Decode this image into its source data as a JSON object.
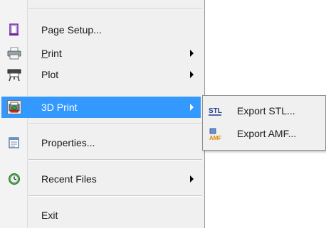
{
  "menu": {
    "items": [
      {
        "id": "page-setup",
        "label": "Page Setup...",
        "icon": "page-setup-icon",
        "submenu": false
      },
      {
        "id": "print",
        "label": "Print",
        "accel": "P",
        "icon": "printer-icon",
        "submenu": true
      },
      {
        "id": "plot",
        "label": "Plot",
        "icon": "plotter-icon",
        "submenu": true
      },
      {
        "id": "3d-print",
        "label": "3D Print",
        "icon": "3d-printer-icon",
        "submenu": true,
        "active": true
      },
      {
        "id": "properties",
        "label": "Properties...",
        "icon": "properties-icon",
        "submenu": false
      },
      {
        "id": "recent-files",
        "label": "Recent Files",
        "icon": "recent-files-icon",
        "submenu": true
      },
      {
        "id": "exit",
        "label": "Exit",
        "submenu": false
      }
    ]
  },
  "submenu_3d_print": {
    "items": [
      {
        "id": "export-stl",
        "label": "Export STL...",
        "icon": "stl-icon",
        "icon_text": "STL"
      },
      {
        "id": "export-amf",
        "label": "Export AMF...",
        "icon": "amf-icon",
        "icon_text": "AMF"
      }
    ]
  },
  "colors": {
    "highlight": "#3399ff",
    "menu_bg": "#f0f0f0",
    "separator": "#c8c8c8"
  }
}
